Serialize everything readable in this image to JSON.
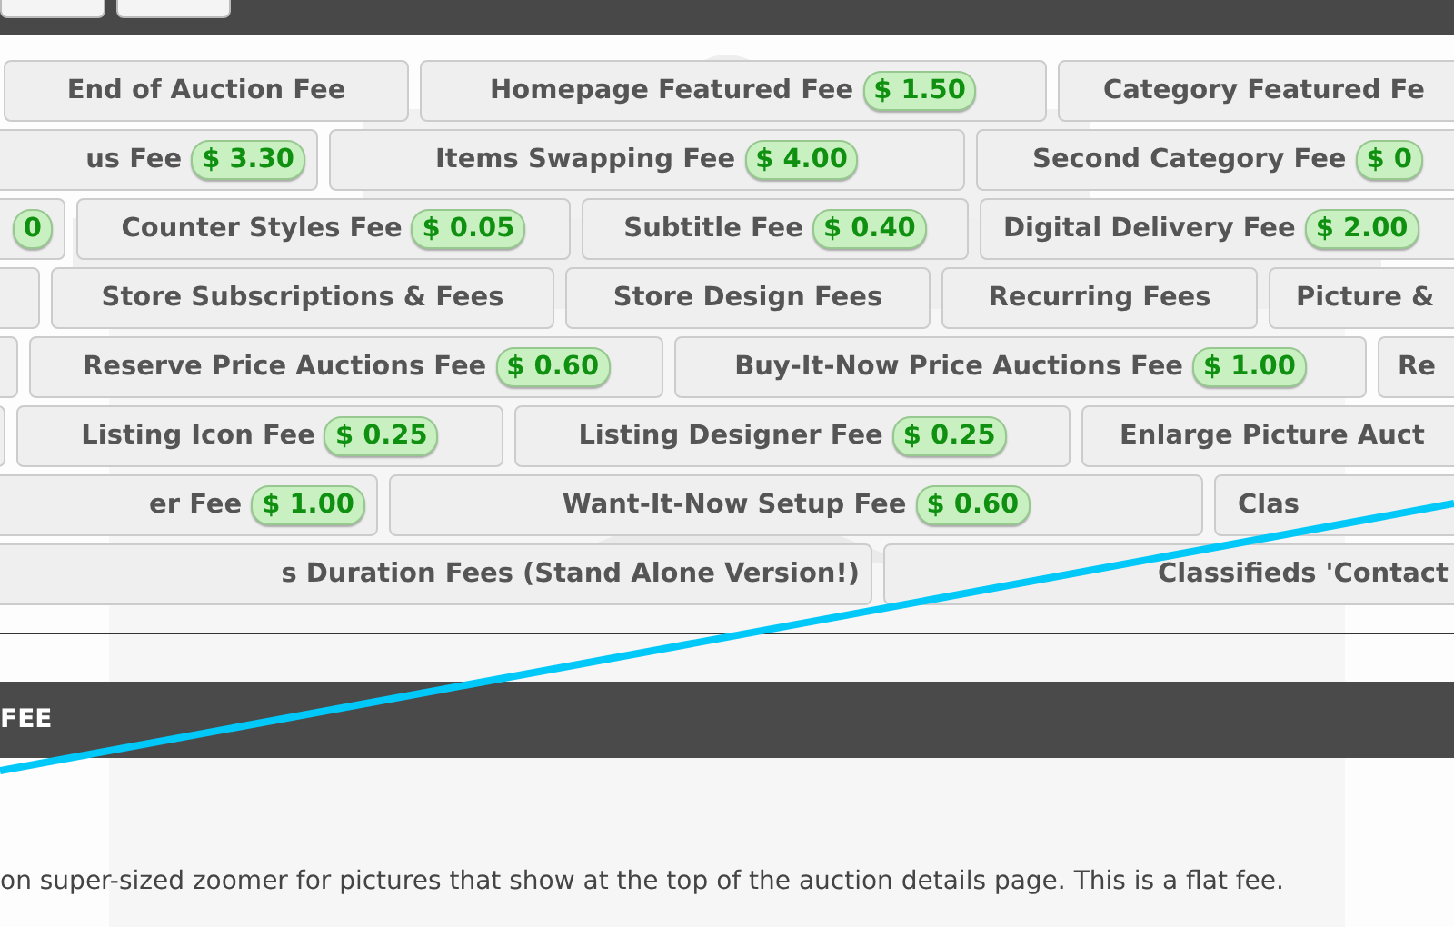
{
  "fee_rows": [
    {
      "buttons": [
        {
          "kind": "fee",
          "label": "End of Auction Fee"
        },
        {
          "kind": "fee",
          "label": "Homepage Featured Fee",
          "price": "$ 1.50"
        },
        {
          "kind": "fee",
          "label": "Category Featured Fe"
        }
      ]
    },
    {
      "buttons": [
        {
          "kind": "fee",
          "label": "us Fee",
          "price": "$ 3.30"
        },
        {
          "kind": "fee",
          "label": "Items Swapping Fee",
          "price": "$ 4.00"
        },
        {
          "kind": "fee",
          "label": "Second Category Fee",
          "price": "$ 0"
        }
      ]
    },
    {
      "buttons": [
        {
          "kind": "fee",
          "price": "0"
        },
        {
          "kind": "fee",
          "label": "Counter Styles Fee",
          "price": "$ 0.05"
        },
        {
          "kind": "fee",
          "label": "Subtitle Fee",
          "price": "$ 0.40"
        },
        {
          "kind": "fee",
          "label": "Digital Delivery Fee",
          "price": "$ 2.00"
        }
      ]
    },
    {
      "buttons": [
        {
          "kind": "blank"
        },
        {
          "kind": "fee",
          "label": "Store Subscriptions & Fees"
        },
        {
          "kind": "fee",
          "label": "Store Design Fees"
        },
        {
          "kind": "fee",
          "label": "Recurring Fees"
        },
        {
          "kind": "fee",
          "label": "Picture &"
        }
      ]
    },
    {
      "buttons": [
        {
          "kind": "blank"
        },
        {
          "kind": "fee",
          "label": "Reserve Price Auctions Fee",
          "price": "$ 0.60"
        },
        {
          "kind": "fee",
          "label": "Buy-It-Now Price Auctions Fee",
          "price": "$ 1.00"
        },
        {
          "kind": "fee",
          "label": "Re"
        }
      ]
    },
    {
      "buttons": [
        {
          "kind": "blank"
        },
        {
          "kind": "fee",
          "label": "Listing Icon Fee",
          "price": "$ 0.25"
        },
        {
          "kind": "fee",
          "label": "Listing Designer Fee",
          "price": "$ 0.25"
        },
        {
          "kind": "fee",
          "label": "Enlarge Picture Auct"
        }
      ]
    },
    {
      "buttons": [
        {
          "kind": "fee",
          "label": "er Fee",
          "price": "$ 1.00"
        },
        {
          "kind": "fee",
          "label": "Want-It-Now Setup Fee",
          "price": "$ 0.60"
        },
        {
          "kind": "fee",
          "label": "Clas"
        }
      ]
    },
    {
      "buttons": [
        {
          "kind": "fee",
          "label": "s Duration Fees (Stand Alone Version!)"
        },
        {
          "kind": "fee",
          "label": "Classifieds 'Contact"
        }
      ]
    }
  ],
  "section": {
    "title": "FEE",
    "description": "on super-sized zoomer for pictures that show at the top of the auction details page. This is a flat fee."
  }
}
